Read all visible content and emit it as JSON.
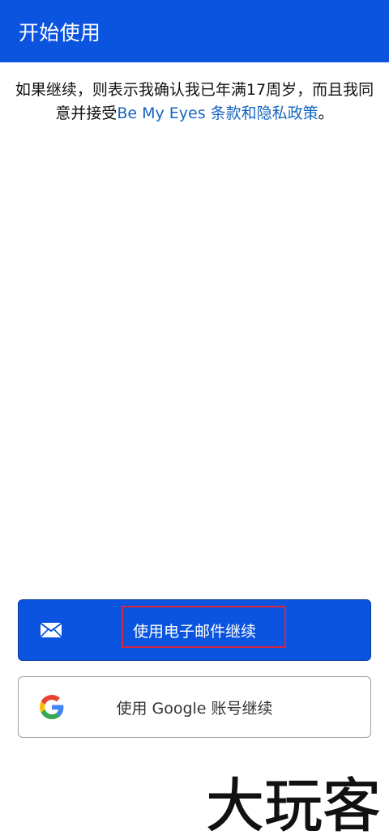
{
  "header": {
    "title": "开始使用",
    "background": "#0a54df"
  },
  "consent": {
    "text_before": "如果继续，则表示我确认我已年满17周岁，而且我同意并接受",
    "link": "Be My Eyes 条款和隐私政策",
    "text_after": "。"
  },
  "buttons": {
    "email_label": "使用电子邮件继续",
    "email_icon": "envelope-icon",
    "google_label": "使用 Google 账号继续",
    "google_icon": "google-g-icon"
  },
  "watermark": {
    "text": "大玩客"
  },
  "colors": {
    "primary": "#0a54df",
    "link": "#1565c0",
    "highlight": "#d7263d"
  }
}
